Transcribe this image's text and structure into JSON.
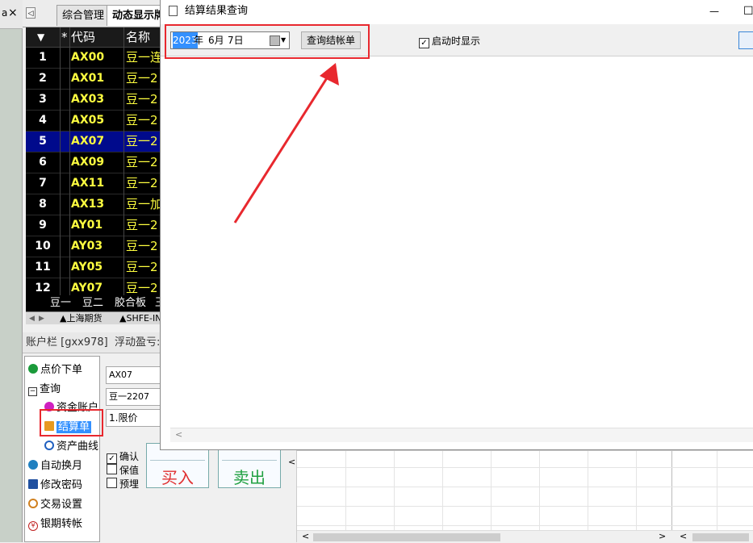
{
  "left_strip": {
    "top_glyph": "a",
    "close_glyph": "×"
  },
  "tabs": {
    "scroll_left": "◁",
    "items": [
      "综合管理",
      "动态显示牌"
    ]
  },
  "grid": {
    "headers": {
      "sort": "▼",
      "star": "*",
      "code": "代码",
      "name": "名称"
    },
    "rows": [
      {
        "num": "1",
        "code": "AX00",
        "name": "豆一连"
      },
      {
        "num": "2",
        "code": "AX01",
        "name": "豆一2"
      },
      {
        "num": "3",
        "code": "AX03",
        "name": "豆一2"
      },
      {
        "num": "4",
        "code": "AX05",
        "name": "豆一2"
      },
      {
        "num": "5",
        "code": "AX07",
        "name": "豆一2"
      },
      {
        "num": "6",
        "code": "AX09",
        "name": "豆一2"
      },
      {
        "num": "7",
        "code": "AX11",
        "name": "豆一2"
      },
      {
        "num": "8",
        "code": "AX13",
        "name": "豆一加"
      },
      {
        "num": "9",
        "code": "AY01",
        "name": "豆一2"
      },
      {
        "num": "10",
        "code": "AY03",
        "name": "豆一2"
      },
      {
        "num": "11",
        "code": "AY05",
        "name": "豆一2"
      },
      {
        "num": "12",
        "code": "AY07",
        "name": "豆一2"
      }
    ],
    "boards": [
      "豆一",
      "豆二",
      "胶合板",
      "玉"
    ],
    "sheets": [
      "▲上海期货",
      "▲SHFE-IN"
    ]
  },
  "account_bar": {
    "label": "账户栏 [gxx978]",
    "float_pl": "浮动盈亏:"
  },
  "tree": {
    "order": "点价下单",
    "query": "查询",
    "funds": "资金账户",
    "settlement": "结算单",
    "asset_curve": "资产曲线",
    "auto_roll": "自动换月",
    "change_pwd": "修改密码",
    "trade_settings": "交易设置",
    "bank_transfer": "银期转帐"
  },
  "order_form": {
    "code": "AX07",
    "contract": "豆一2207",
    "price_type": "1.限价",
    "confirm": "确认",
    "hedge": "保值",
    "pre_order": "预埋",
    "buy": "买入",
    "sell": "卖出"
  },
  "dialog": {
    "title": "结算结果查询",
    "minimize": "—",
    "maximize": "☐",
    "date": {
      "year": "2023",
      "year_suffix": "年",
      "month": "6月",
      "day": "7日"
    },
    "query_button": "查询结帐单",
    "startup_show": "启动时显示",
    "scroll_left": "<"
  },
  "lower": {
    "scroll_left": "<",
    "scroll_right": ">"
  },
  "colors": {
    "annotation_red": "#e8282e",
    "selected_row": "#000a8c",
    "code_yellow": "#ffff40"
  }
}
